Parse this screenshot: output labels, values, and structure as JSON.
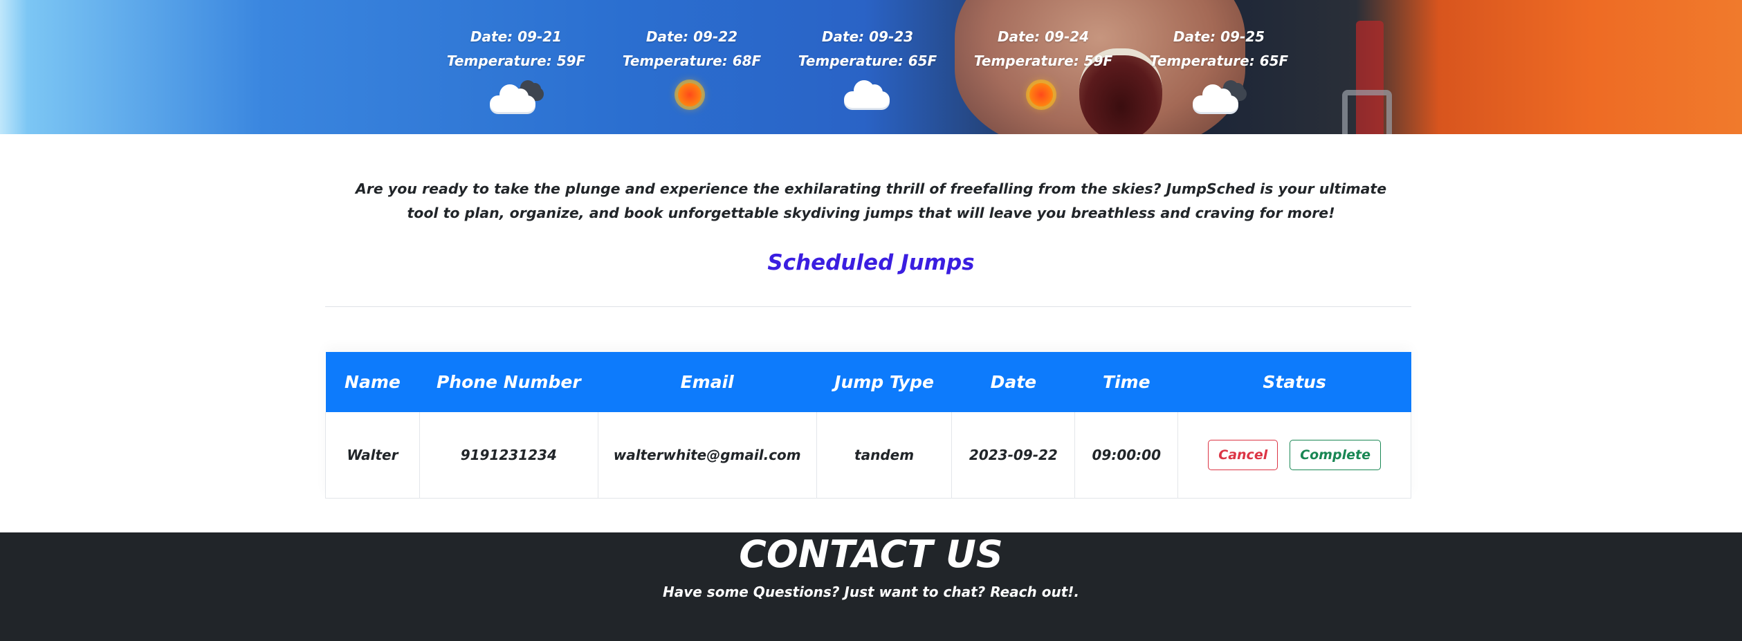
{
  "forecast": [
    {
      "date": "Date: 09-21",
      "temperature": "Temperature: 59F",
      "icon": "partly-cloudy-icon"
    },
    {
      "date": "Date: 09-22",
      "temperature": "Temperature: 68F",
      "icon": "sun-icon"
    },
    {
      "date": "Date: 09-23",
      "temperature": "Temperature: 65F",
      "icon": "cloud-icon"
    },
    {
      "date": "Date: 09-24",
      "temperature": "Temperature: 59F",
      "icon": "sun-icon"
    },
    {
      "date": "Date: 09-25",
      "temperature": "Temperature: 65F",
      "icon": "partly-cloudy-icon"
    }
  ],
  "intro": {
    "text": "Are you ready to take the plunge and experience the exhilarating thrill of freefalling from the skies? JumpSched is your ultimate tool to plan, organize, and book unforgettable skydiving jumps that will leave you breathless and craving for more!"
  },
  "jumps": {
    "title": "Scheduled Jumps",
    "columns": [
      "Name",
      "Phone Number",
      "Email",
      "Jump Type",
      "Date",
      "Time",
      "Status"
    ],
    "rows": [
      {
        "name": "Walter",
        "phone": "9191231234",
        "email": "walterwhite@gmail.com",
        "jump_type": "tandem",
        "date": "2023-09-22",
        "time": "09:00:00",
        "cancel_label": "Cancel",
        "complete_label": "Complete"
      }
    ]
  },
  "footer": {
    "title": "CONTACT US",
    "subtitle": "Have some Questions? Just want to chat? Reach out!."
  },
  "colors": {
    "header_blue": "#0d7bfc",
    "title_purple": "#3a1ee0",
    "cancel_red": "#dc3545",
    "complete_green": "#198754",
    "footer_dark": "#212529"
  }
}
